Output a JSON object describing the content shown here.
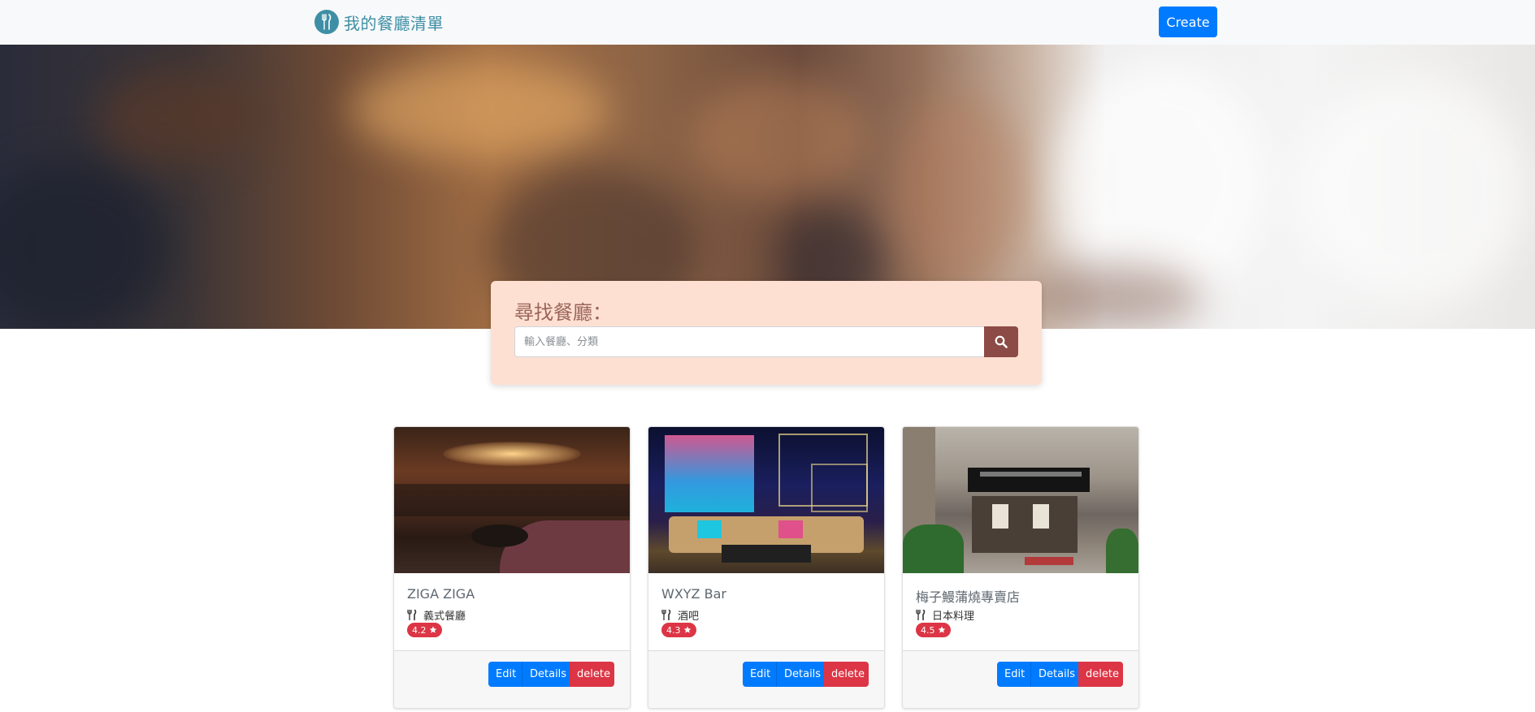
{
  "navbar": {
    "brand_text": "我的餐廳清單",
    "create_label": "Create",
    "colors": {
      "brand": "#3e8fa5",
      "create": "#007bff"
    }
  },
  "search": {
    "title": "尋找餐廳：",
    "placeholder": "輸入餐廳、分類",
    "value": ""
  },
  "restaurants": [
    {
      "name": "ZIGA ZIGA",
      "category": "義式餐廳",
      "rating": "4.2",
      "icon": "utensils-icon"
    },
    {
      "name": "WXYZ Bar",
      "category": "酒吧",
      "rating": "4.3",
      "icon": "utensils-icon"
    },
    {
      "name": "梅子鰻蒲燒專賣店",
      "category": "日本料理",
      "rating": "4.5",
      "icon": "utensils-icon"
    }
  ],
  "card_actions": {
    "edit_label": "Edit",
    "details_label": "Details",
    "delete_label": "delete"
  }
}
